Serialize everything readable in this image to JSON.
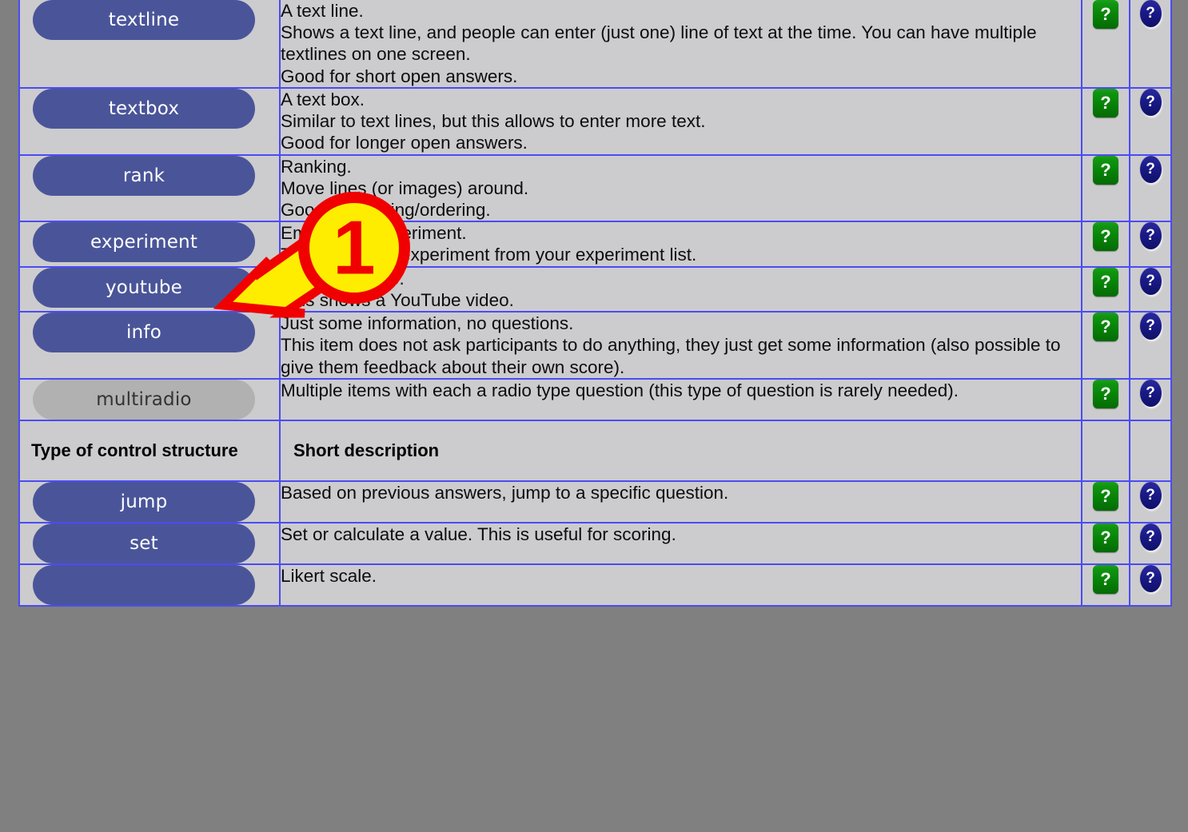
{
  "theme": {
    "page_background": "#808080",
    "cell_background": "#ccccce",
    "cell_border": "#4b4bf5",
    "button_blue": "#4a5599",
    "button_disabled_gray": "#b1b1b1",
    "header_orange": "#ffa400",
    "green_help": "#0b8a0b",
    "blue_help": "#16167e",
    "callout_yellow": "#ffed00",
    "callout_red": "#f00000"
  },
  "table": {
    "columns": [
      "Type of control structure",
      "Short description",
      "",
      ""
    ],
    "rows": [
      {
        "button": {
          "label": "textline",
          "style": "blue"
        },
        "description": [
          "A text line.",
          "Shows a text line, and people can enter (just one) line of text at the time. You can have multiple textlines on one screen.",
          "Good for short open answers."
        ],
        "green_help": "?",
        "blue_help": "?"
      },
      {
        "button": {
          "label": "textbox",
          "style": "blue"
        },
        "description": [
          "A text box.",
          "Similar to text lines, but this allows to enter more text.",
          "Good for longer open answers."
        ],
        "green_help": "?",
        "blue_help": "?"
      },
      {
        "button": {
          "label": "rank",
          "style": "blue"
        },
        "description": [
          "Ranking.",
          "Move lines (or images) around.",
          "Good for ranking/ordering."
        ],
        "green_help": "?",
        "blue_help": "?"
      },
      {
        "button": {
          "label": "experiment",
          "style": "blue"
        },
        "description": [
          "Embedded experiment.",
          "This shows an experiment from your experiment list."
        ],
        "green_help": "?",
        "blue_help": "?"
      },
      {
        "button": {
          "label": "youtube",
          "style": "blue"
        },
        "description": [
          "YouTube video.",
          "This shows a YouTube video."
        ],
        "green_help": "?",
        "blue_help": "?"
      },
      {
        "button": {
          "label": "info",
          "style": "blue"
        },
        "description": [
          "Just some information, no questions.",
          "This item does not ask participants to do anything, they just get some information (also possible to give them feedback about their own score)."
        ],
        "green_help": "?",
        "blue_help": "?"
      },
      {
        "button": {
          "label": "multiradio",
          "style": "gray"
        },
        "description": [
          "Multiple items with each a radio type question (this type of question is rarely needed)."
        ],
        "green_help": "?",
        "blue_help": "?"
      }
    ],
    "section_header": {
      "type_label": "Type of control structure",
      "description_label": "Short description"
    },
    "control_rows": [
      {
        "button": {
          "label": "jump",
          "style": "blue"
        },
        "description": [
          "Based on previous answers, jump to a specific question."
        ],
        "green_help": "?",
        "blue_help": "?"
      },
      {
        "button": {
          "label": "set",
          "style": "blue"
        },
        "description": [
          "Set or calculate a value. This is useful for scoring."
        ],
        "green_help": "?",
        "blue_help": "?"
      },
      {
        "button": {
          "label": "",
          "style": "blue"
        },
        "description": [
          "Likert scale."
        ],
        "green_help": "?",
        "blue_help": "?"
      }
    ]
  },
  "annotation": {
    "badge_number": "1",
    "target": "experiment-button"
  }
}
